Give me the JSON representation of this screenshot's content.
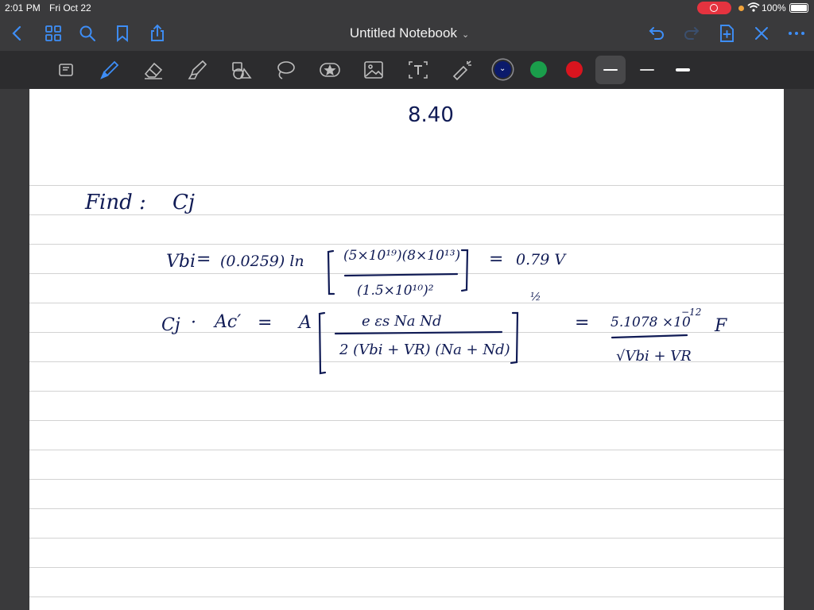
{
  "status_bar": {
    "time": "2:01 PM",
    "date": "Fri Oct 22",
    "battery": "100%"
  },
  "nav_bar": {
    "title": "Untitled Notebook",
    "icons": [
      "chevron-left-icon",
      "grid-icon",
      "search-icon",
      "bookmark-icon",
      "share-icon",
      "undo-icon",
      "redo-icon",
      "add-page-icon",
      "close-icon",
      "more-icon"
    ]
  },
  "toolbar": {
    "tools": [
      "lasso-select-icon",
      "pen-icon",
      "eraser-icon",
      "highlighter-icon",
      "shapes-icon",
      "lasso-icon",
      "sticker-icon",
      "image-icon",
      "text-icon",
      "laser-pointer-icon"
    ],
    "colors": [
      "#0b1a6b",
      "#1a9e4b",
      "#d9141e"
    ],
    "selected_color": "#0b1a6b"
  },
  "page": {
    "title": "8.40",
    "find_label": "Find :",
    "find_var": "Cj",
    "vbi_label": "Vbi",
    "eq": "=",
    "vbi_coef": "(0.0259) ln",
    "vbi_numerator": "(5×10¹⁹)(8×10¹³)",
    "vbi_denominator": "(1.5×10¹⁰)²",
    "vbi_result": "0.79 V",
    "cj_label": "Cj",
    "cj_dot": "·",
    "acp": "Ac′",
    "a_label": "A",
    "cj_numerator": "e εs Na Nd",
    "cj_denominator": "2 (Vbi + VR) (Na + Nd)",
    "half": "½",
    "result_numerator": "5.1078 ×10",
    "result_exp": "−12",
    "result_denominator": "√Vbi + VR",
    "unit": "F"
  }
}
